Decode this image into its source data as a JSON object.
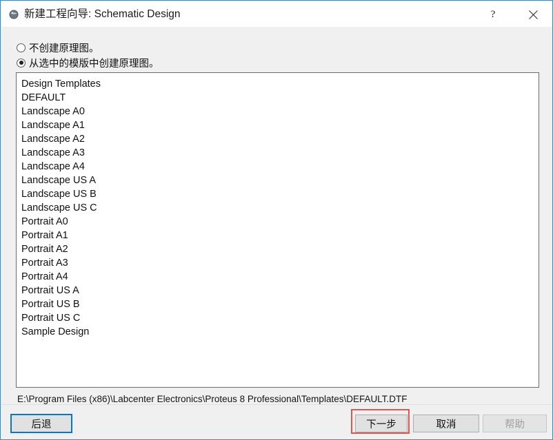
{
  "window": {
    "title": "新建工程向导: Schematic Design",
    "icon": "sphere-icon",
    "accent_border": "#2e8fc7",
    "body_bg": "#f0f0f0"
  },
  "titlebar": {
    "help_label": "?",
    "help_icon": "question-mark-icon",
    "close_icon": "close-icon"
  },
  "options": [
    {
      "label": "不创建原理图。",
      "checked": false
    },
    {
      "label": "从选中的模版中创建原理图。",
      "checked": true
    }
  ],
  "template_list": {
    "items": [
      "Design Templates",
      "DEFAULT",
      "Landscape A0",
      "Landscape A1",
      "Landscape A2",
      "Landscape A3",
      "Landscape A4",
      "Landscape US A",
      "Landscape US B",
      "Landscape US C",
      "Portrait A0",
      "Portrait A1",
      "Portrait A2",
      "Portrait A3",
      "Portrait A4",
      "Portrait US A",
      "Portrait US B",
      "Portrait US C",
      "Sample Design"
    ]
  },
  "path": "E:\\Program Files (x86)\\Labcenter Electronics\\Proteus 8 Professional\\Templates\\DEFAULT.DTF",
  "footer": {
    "back_label": "后退",
    "next_label": "下一步",
    "cancel_label": "取消",
    "help_label": "帮助",
    "help_disabled": true
  },
  "annotation": {
    "color": "#e0554e",
    "target": "next-button"
  }
}
